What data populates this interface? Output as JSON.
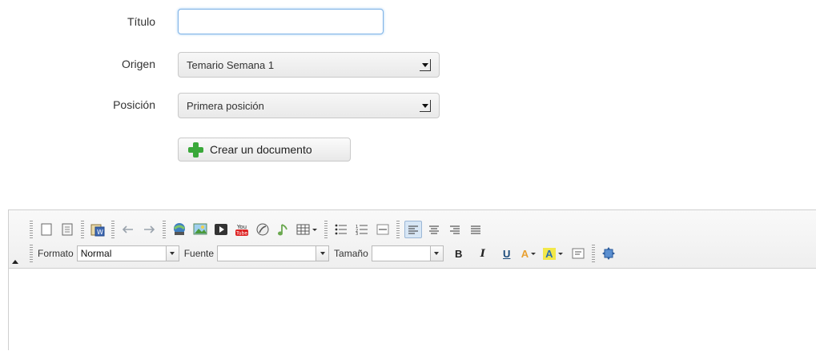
{
  "form": {
    "titulo_label": "Título",
    "titulo_value": "",
    "origen_label": "Origen",
    "origen_value": "Temario Semana 1",
    "posicion_label": "Posición",
    "posicion_value": "Primera posición",
    "create_button_label": "Crear un documento"
  },
  "editor": {
    "toolbar_row1_icons": [
      "new-page-icon",
      "templates-icon",
      "paste-from-word-icon",
      "undo-icon",
      "redo-icon",
      "link-icon",
      "image-icon",
      "video-icon",
      "youtube-icon",
      "flash-icon",
      "audio-icon",
      "table-icon",
      "bulleted-list-icon",
      "numbered-list-icon",
      "horizontal-rule-icon",
      "align-left-icon",
      "align-center-icon",
      "align-right-icon",
      "justify-icon"
    ],
    "formato_label": "Formato",
    "formato_value": "Normal",
    "fuente_label": "Fuente",
    "fuente_value": "",
    "tamano_label": "Tamaño",
    "tamano_value": "",
    "bold_label": "B",
    "italic_label": "I",
    "underline_label": "U",
    "text_color_label": "A",
    "bg_color_label": "A",
    "youtube_label_top": "You",
    "youtube_label_bottom": "Tube",
    "content": ""
  },
  "colors": {
    "accent_blue": "#7fb3e6",
    "plus_green": "#3aa83a",
    "active_button_bg": "#d7e6f5"
  }
}
